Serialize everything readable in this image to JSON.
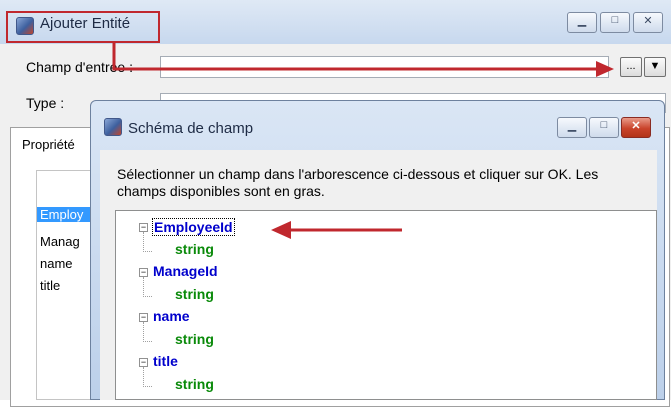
{
  "back_window": {
    "title": "Ajouter Entité",
    "caption_buttons": [
      "minimize",
      "maximize",
      "close"
    ],
    "field_label": "Champ d'entrée :",
    "field_value": "",
    "browse_label": "...",
    "dropdown_icon": "dropdown-arrow",
    "type_label": "Type :",
    "type_value": "",
    "group_tab": "Propriété",
    "list_items": [
      "Employ",
      "Manag",
      "name",
      "title"
    ],
    "selected_index": 0
  },
  "dialog": {
    "title": "Schéma de champ",
    "instruction": "Sélectionner un champ dans l'arborescence ci-dessous et cliquer sur OK. Les champs disponibles sont en gras.",
    "tree": [
      {
        "name": "EmployeeId",
        "type": "string",
        "focused": true
      },
      {
        "name": "ManageId",
        "type": "string",
        "focused": false
      },
      {
        "name": "name",
        "type": "string",
        "focused": false
      },
      {
        "name": "title",
        "type": "string",
        "focused": false
      }
    ]
  },
  "annotations": {
    "highlight_color": "#c0282e",
    "arrow_color": "#c0282e"
  }
}
